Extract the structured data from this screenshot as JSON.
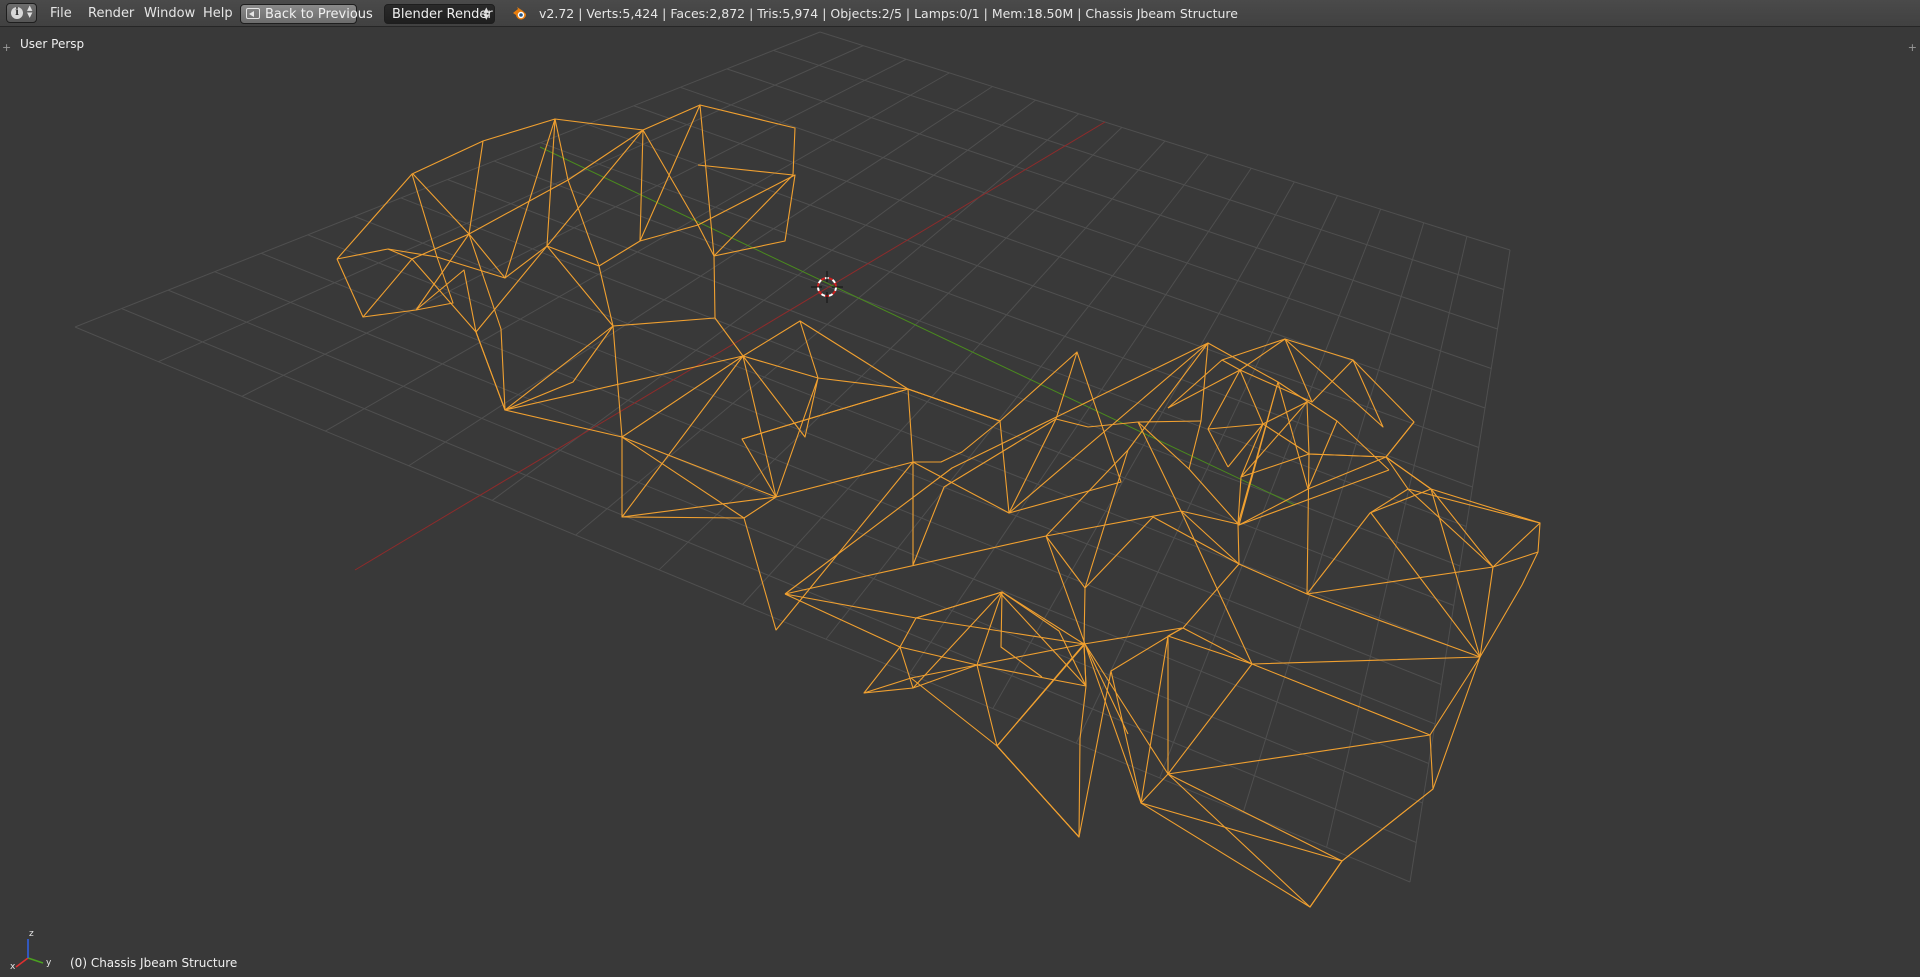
{
  "header": {
    "editor_type_icon": "info-icon",
    "menus": [
      "File",
      "Render",
      "Window",
      "Help"
    ],
    "back_button_label": "Back to Previous",
    "back_button_icon": "back-screen-icon",
    "render_engine": "Blender Render",
    "logo_icon": "blender-logo-icon",
    "stats": "v2.72 | Verts:5,424 | Faces:2,872 | Tris:5,974 | Objects:2/5 | Lamps:0/1 | Mem:18.50M | Chassis Jbeam Structure"
  },
  "viewport": {
    "view_label": "User Persp",
    "object_label": "(0) Chassis Jbeam Structure",
    "axis_gizmo": {
      "x": "x",
      "y": "y",
      "z": "z"
    },
    "colors": {
      "background": "#393939",
      "grid": "#4f4f4f",
      "x_axis": "#8e2b2b",
      "y_axis": "#4a8a1e",
      "wireframe_selected": "#f0a030",
      "header": "#444444"
    },
    "icons": [
      "3d-cursor-icon",
      "axis-gizmo-icon",
      "region-expand-icon"
    ]
  }
}
